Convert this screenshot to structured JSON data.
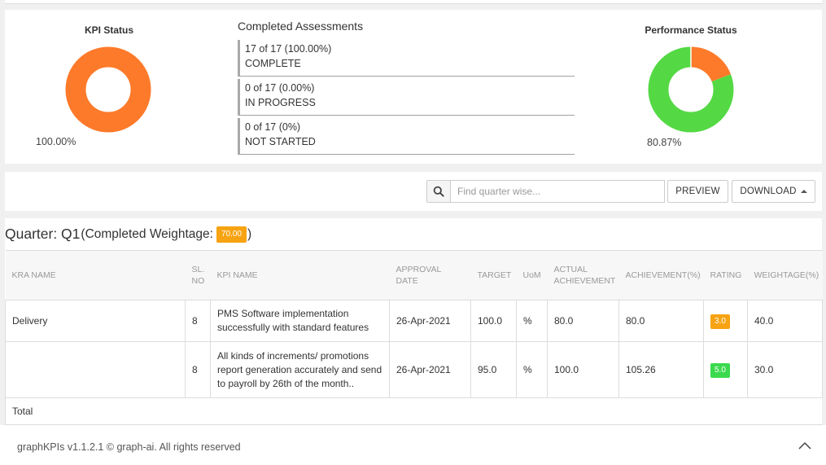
{
  "kpi_status": {
    "title": "KPI Status",
    "percent_label": "100.00%",
    "segments": [
      {
        "name": "complete",
        "value": 100.0,
        "color": "#fd7a2a"
      }
    ]
  },
  "completed_assessments": {
    "title": "Completed Assessments",
    "items": [
      {
        "count": "17 of 17 (100.00%)",
        "status": "COMPLETE"
      },
      {
        "count": "0 of 17 (0.00%)",
        "status": "IN PROGRESS"
      },
      {
        "count": "0 of 17 (0%)",
        "status": "NOT STARTED"
      }
    ]
  },
  "performance_status": {
    "title": "Performance Status",
    "percent_label": "80.87%",
    "segments": [
      {
        "name": "achieved",
        "value": 80.87,
        "color": "#54d945"
      },
      {
        "name": "remaining",
        "value": 19.13,
        "color": "#fd7a2a"
      }
    ]
  },
  "toolbar": {
    "search_icon": "search-icon",
    "search_placeholder": "Find quarter wise...",
    "search_value": "",
    "preview_label": "PREVIEW",
    "download_label": "DOWNLOAD"
  },
  "quarter": {
    "label": "Quarter: Q1",
    "sub_label_open": "(Completed Weightage: ",
    "weightage": "70.00",
    "sub_label_close": ")",
    "columns": [
      "KRA NAME",
      "SL. NO",
      "KPI NAME",
      "APPROVAL DATE",
      "TARGET",
      "UoM",
      "ACTUAL ACHIEVEMENT",
      "ACHIEVEMENT(%)",
      "RATING",
      "WEIGHTAGE(%)"
    ],
    "rows": [
      {
        "kra": "Delivery",
        "sl": "8",
        "kpi": "PMS Software implementation successfully with standard features",
        "date": "26-Apr-2021",
        "target": "100.0",
        "uom": "%",
        "actual": "80.0",
        "achievement": "80.0",
        "rating": "3.0",
        "rating_color": "#f7a312",
        "weightage": "40.0"
      },
      {
        "kra": "",
        "sl": "8",
        "kpi": "All kinds of increments/ promotions report generation accurately and send to payroll by 26th of the month..",
        "date": "26-Apr-2021",
        "target": "95.0",
        "uom": "%",
        "actual": "100.0",
        "achievement": "105.26",
        "rating": "5.0",
        "rating_color": "#3bd94e",
        "weightage": "30.0"
      }
    ],
    "total_label": "Total"
  },
  "footer": {
    "text": "graphKPIs v1.1.2.1 © graph-ai. All rights reserved",
    "scroll_top_icon": "chevron-up-icon"
  }
}
